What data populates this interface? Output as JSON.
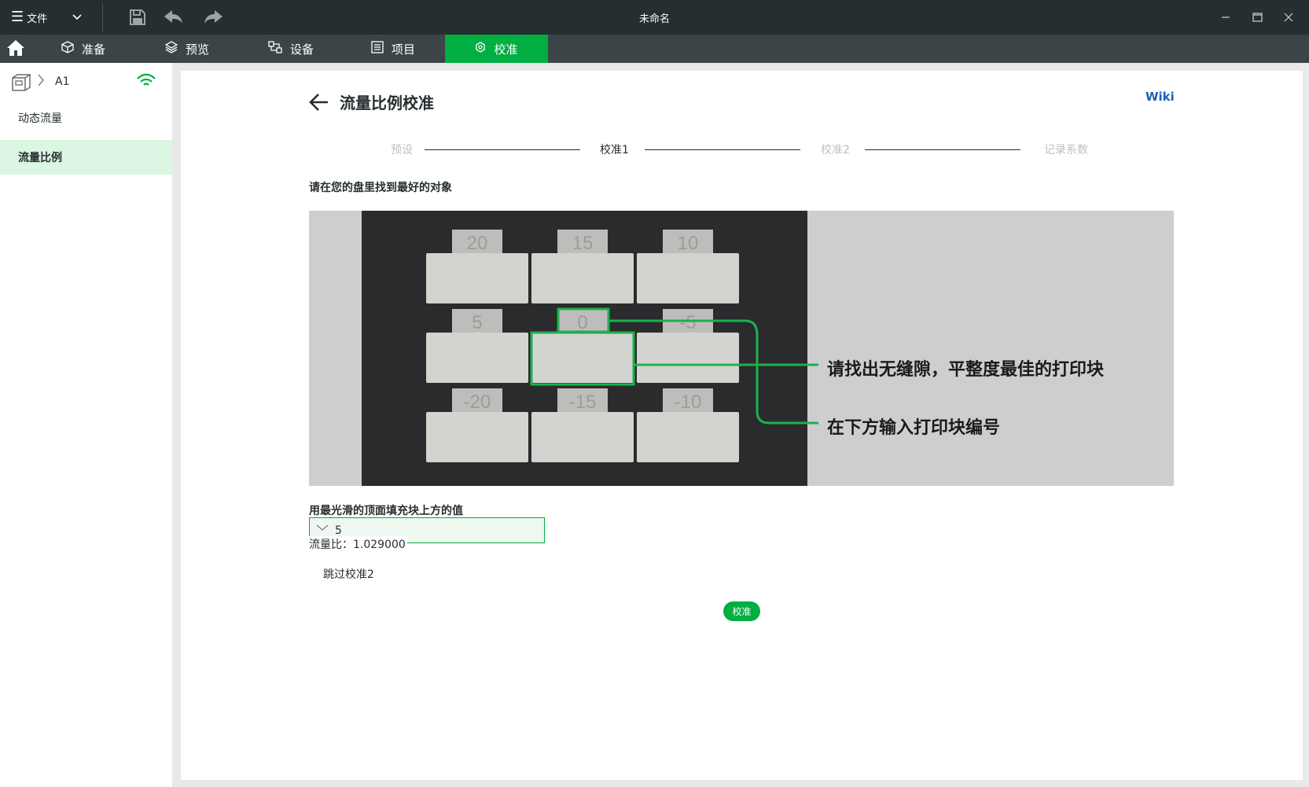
{
  "titlebar": {
    "file_menu_label": "文件",
    "window_title": "未命名",
    "icons": [
      "menu-icon",
      "chevron-down-icon",
      "save-icon",
      "undo-icon",
      "redo-icon",
      "minimize-icon",
      "maximize-icon",
      "close-icon"
    ]
  },
  "tabs": [
    {
      "label": "准备",
      "icon": "cube-icon"
    },
    {
      "label": "预览",
      "icon": "layers-icon"
    },
    {
      "label": "设备",
      "icon": "device-icon"
    },
    {
      "label": "项目",
      "icon": "project-icon"
    },
    {
      "label": "校准",
      "icon": "calibration-icon",
      "active": true
    }
  ],
  "sidebar": {
    "device_name": "A1",
    "items": [
      {
        "label": "动态流量",
        "selected": false
      },
      {
        "label": "流量比例",
        "selected": true
      }
    ]
  },
  "main": {
    "title": "流量比例校准",
    "wiki_label": "Wiki",
    "steps": [
      {
        "label": "预设",
        "state": "done"
      },
      {
        "label": "校准1",
        "state": "current"
      },
      {
        "label": "校准2",
        "state": "pending"
      },
      {
        "label": "记录系数",
        "state": "pending"
      }
    ],
    "instruction": "请在您的盘里找到最好的对象",
    "image": {
      "block_labels_row1": [
        "20",
        "15",
        "10"
      ],
      "block_labels_row2": [
        "5",
        "0",
        "-5"
      ],
      "block_labels_row3": [
        "-20",
        "-15",
        "-10"
      ],
      "callout_1": "请找出无缝隙，平整度最佳的打印块",
      "callout_2": "在下方输入打印块编号"
    },
    "select_label": "用最光滑的顶面填充块上方的值",
    "selected_value": "5",
    "flow_ratio_text": "流量比：1.029000",
    "skip_label": "跳过校准2",
    "calibrate_button": "校准"
  },
  "colors": {
    "accent": "#00ae42",
    "titlebar": "#262e30",
    "tabbar": "#3c4447",
    "wiki_link": "#1f5fb3"
  }
}
